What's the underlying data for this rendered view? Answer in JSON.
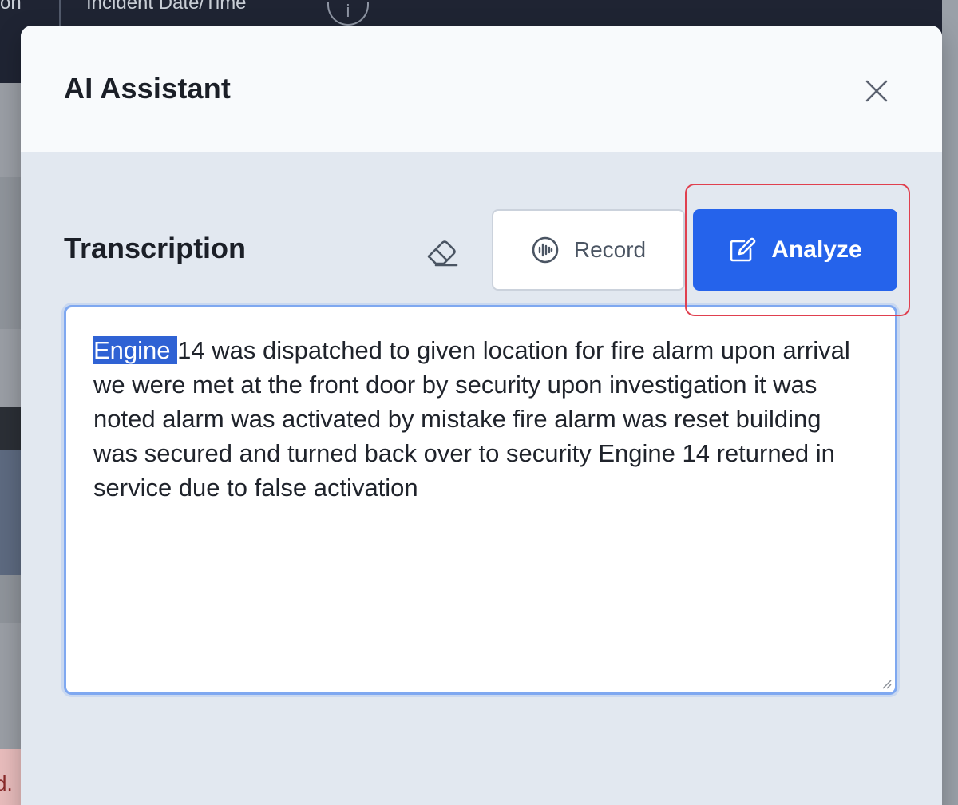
{
  "background": {
    "column_fragment": "on",
    "column_label": "Incident Date/Time",
    "info_glyph": "i",
    "warning_fragment": "d."
  },
  "modal": {
    "title": "AI Assistant",
    "close_icon": "close-icon"
  },
  "transcription": {
    "title": "Transcription",
    "clear_icon": "eraser-icon",
    "record_label": "Record",
    "record_icon": "audio-wave-icon",
    "analyze_label": "Analyze",
    "analyze_icon": "edit-icon",
    "selected_text": "Engine ",
    "text": "14 was dispatched to given location for fire alarm upon arrival we were met at the front door by security upon investigation it was noted alarm was activated by mistake fire alarm was reset building was secured and turned back over to security Engine 14 returned in service due to false activation"
  },
  "colors": {
    "accent": "#2563eb",
    "highlight_outline": "#e0404f",
    "focus_ring": "#7fa8f0"
  }
}
